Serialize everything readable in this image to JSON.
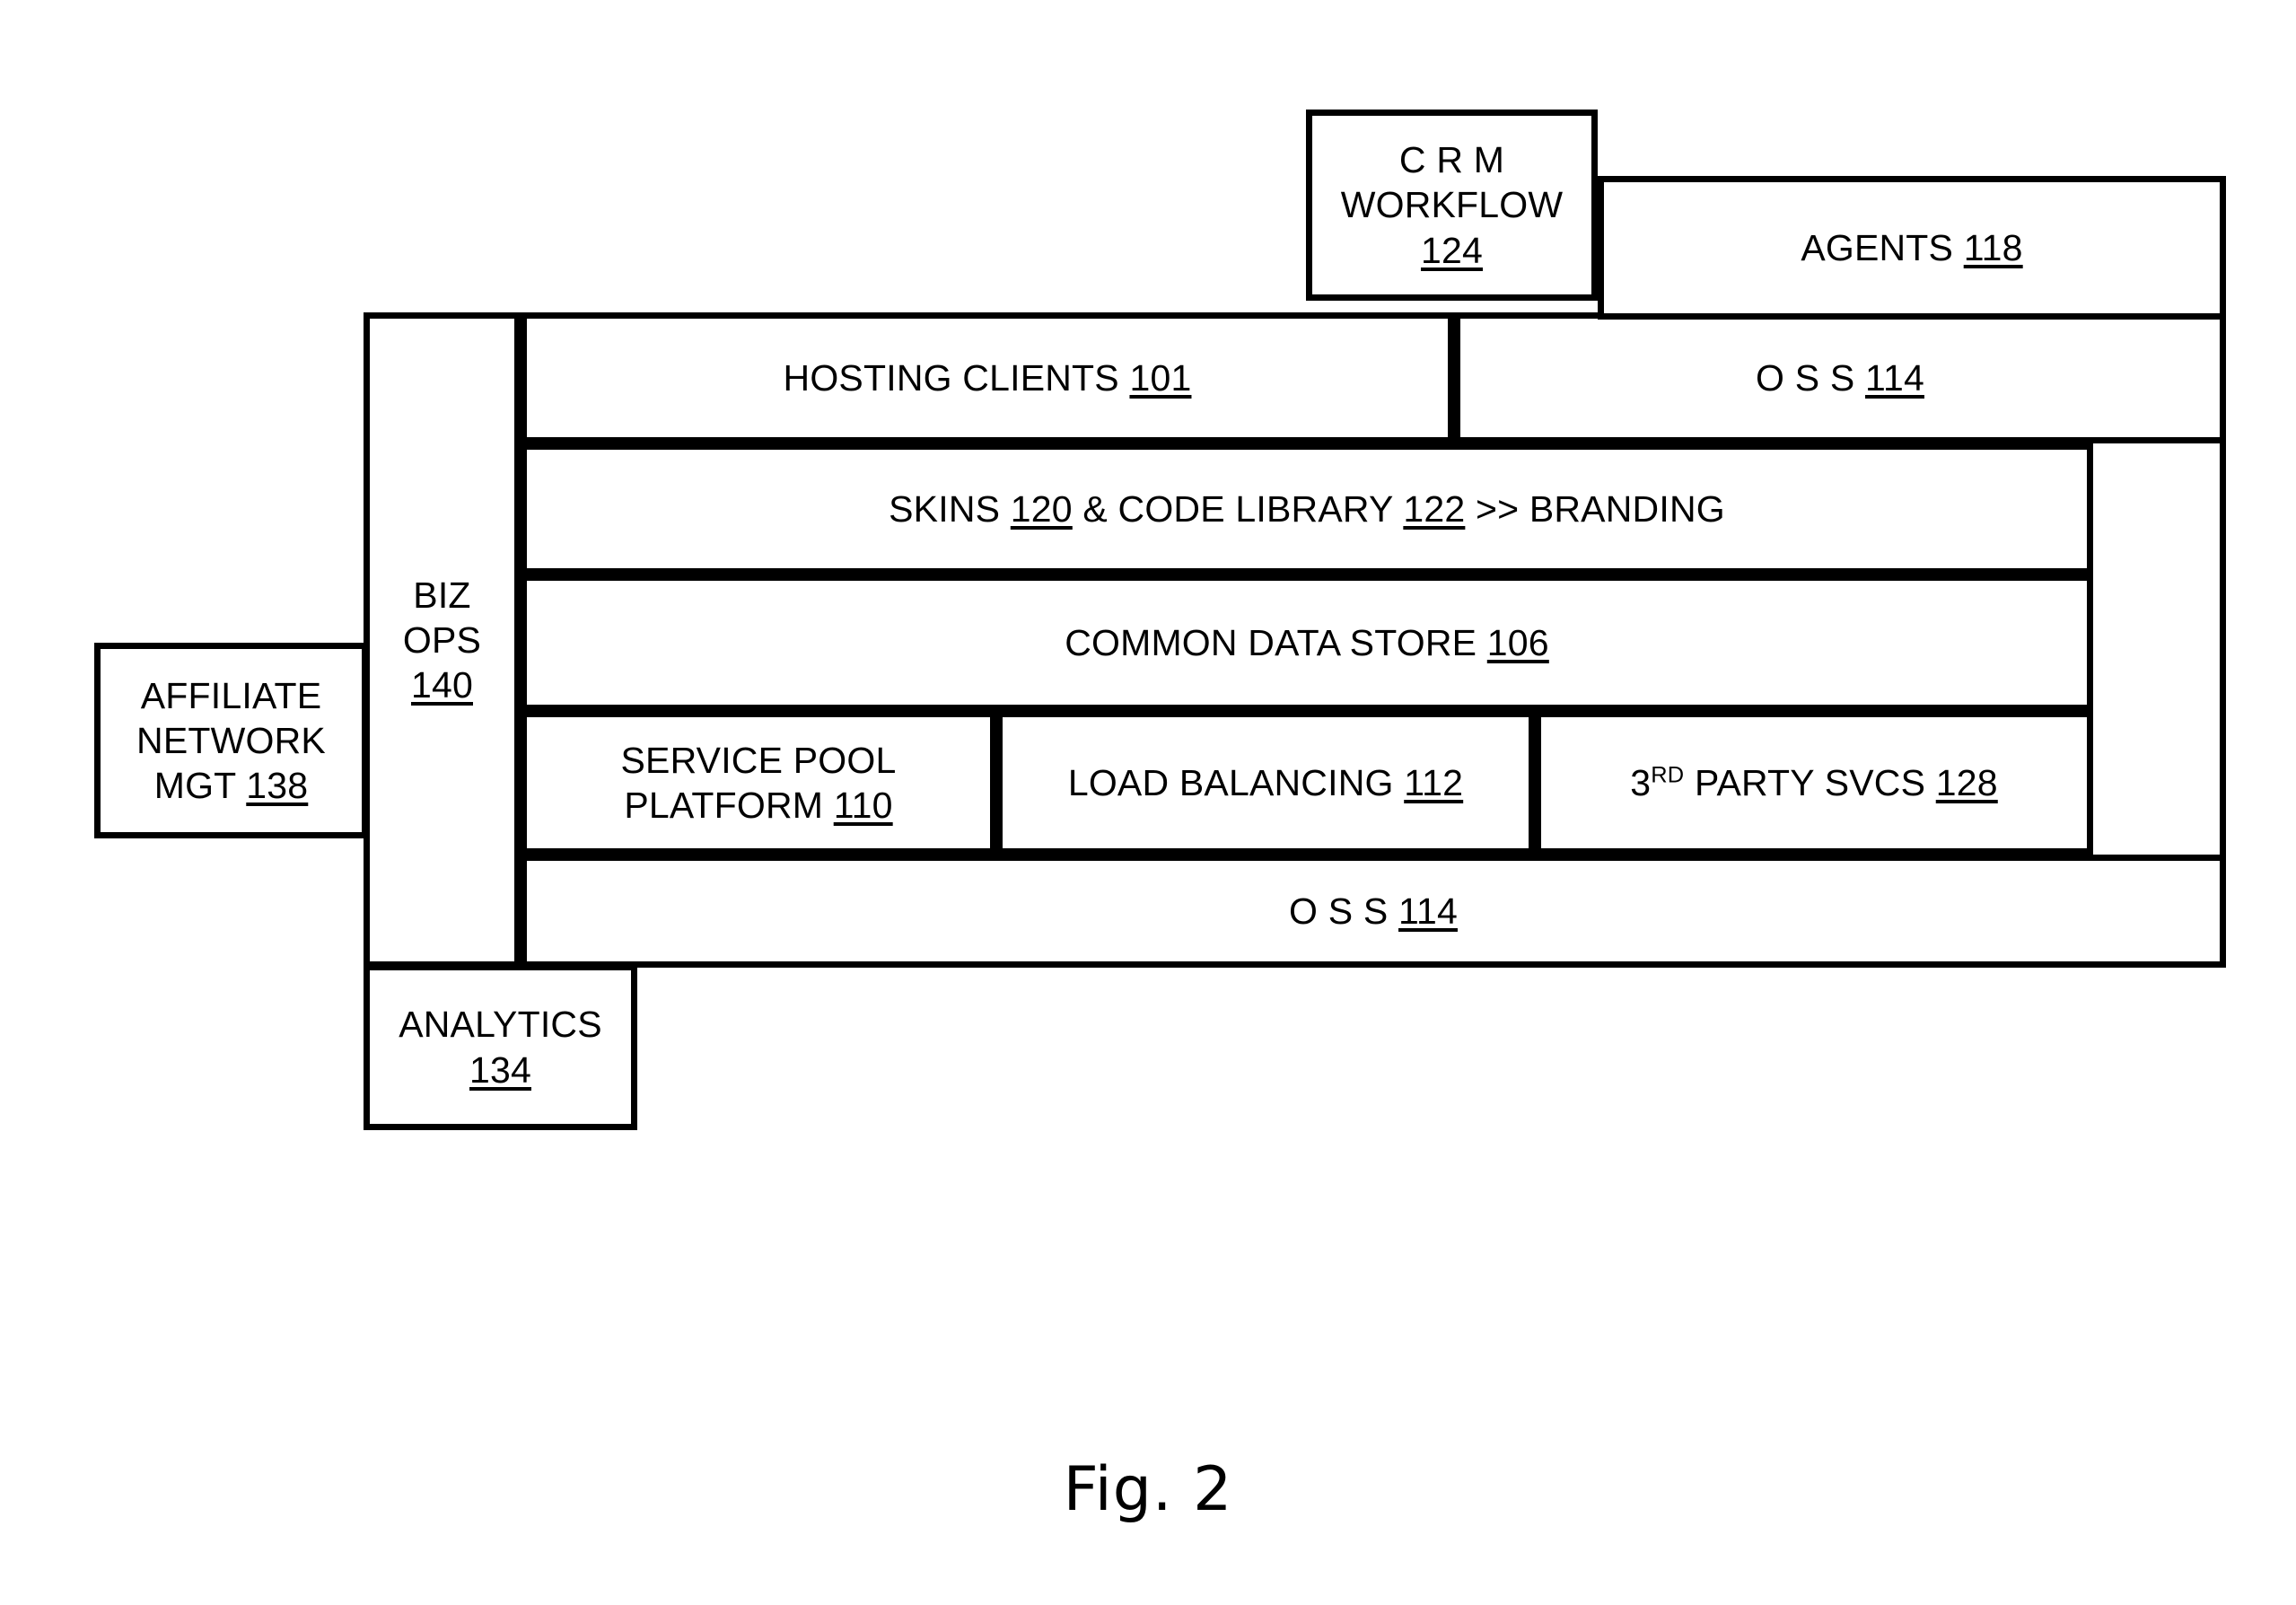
{
  "figure": {
    "caption": "Fig. 2"
  },
  "blocks": {
    "crm_workflow": {
      "line1": "C R M",
      "line2": "WORKFLOW",
      "ref": "124"
    },
    "agents": {
      "label": "AGENTS",
      "ref": "118"
    },
    "biz_ops": {
      "line1": "BIZ",
      "line2": "OPS",
      "ref": "140"
    },
    "hosting_clients": {
      "label": "HOSTING CLIENTS",
      "ref": "101"
    },
    "oss_top": {
      "label": "O S S",
      "ref": "114"
    },
    "skins": {
      "label_a": "SKINS",
      "ref_a": "120",
      "label_b": "& CODE LIBRARY",
      "ref_b": "122",
      "label_c": ">> BRANDING"
    },
    "common_data_store": {
      "label": "COMMON DATA STORE",
      "ref": "106"
    },
    "service_pool": {
      "line1": "SERVICE POOL",
      "line2": "PLATFORM",
      "ref": "110"
    },
    "load_balancing": {
      "label": "LOAD BALANCING",
      "ref": "112"
    },
    "third_party": {
      "prefix": "3",
      "ordinal": "RD",
      "label": "PARTY SVCS",
      "ref": "128"
    },
    "oss_bottom": {
      "label": "O S S",
      "ref": "114"
    },
    "affiliate_network": {
      "line1": "AFFILIATE",
      "line2": "NETWORK",
      "line3": "MGT",
      "ref": "138"
    },
    "analytics": {
      "label": "ANALYTICS",
      "ref": "134"
    }
  },
  "colors": {
    "stroke": "#000000",
    "fill": "#ffffff",
    "text": "#000000"
  }
}
